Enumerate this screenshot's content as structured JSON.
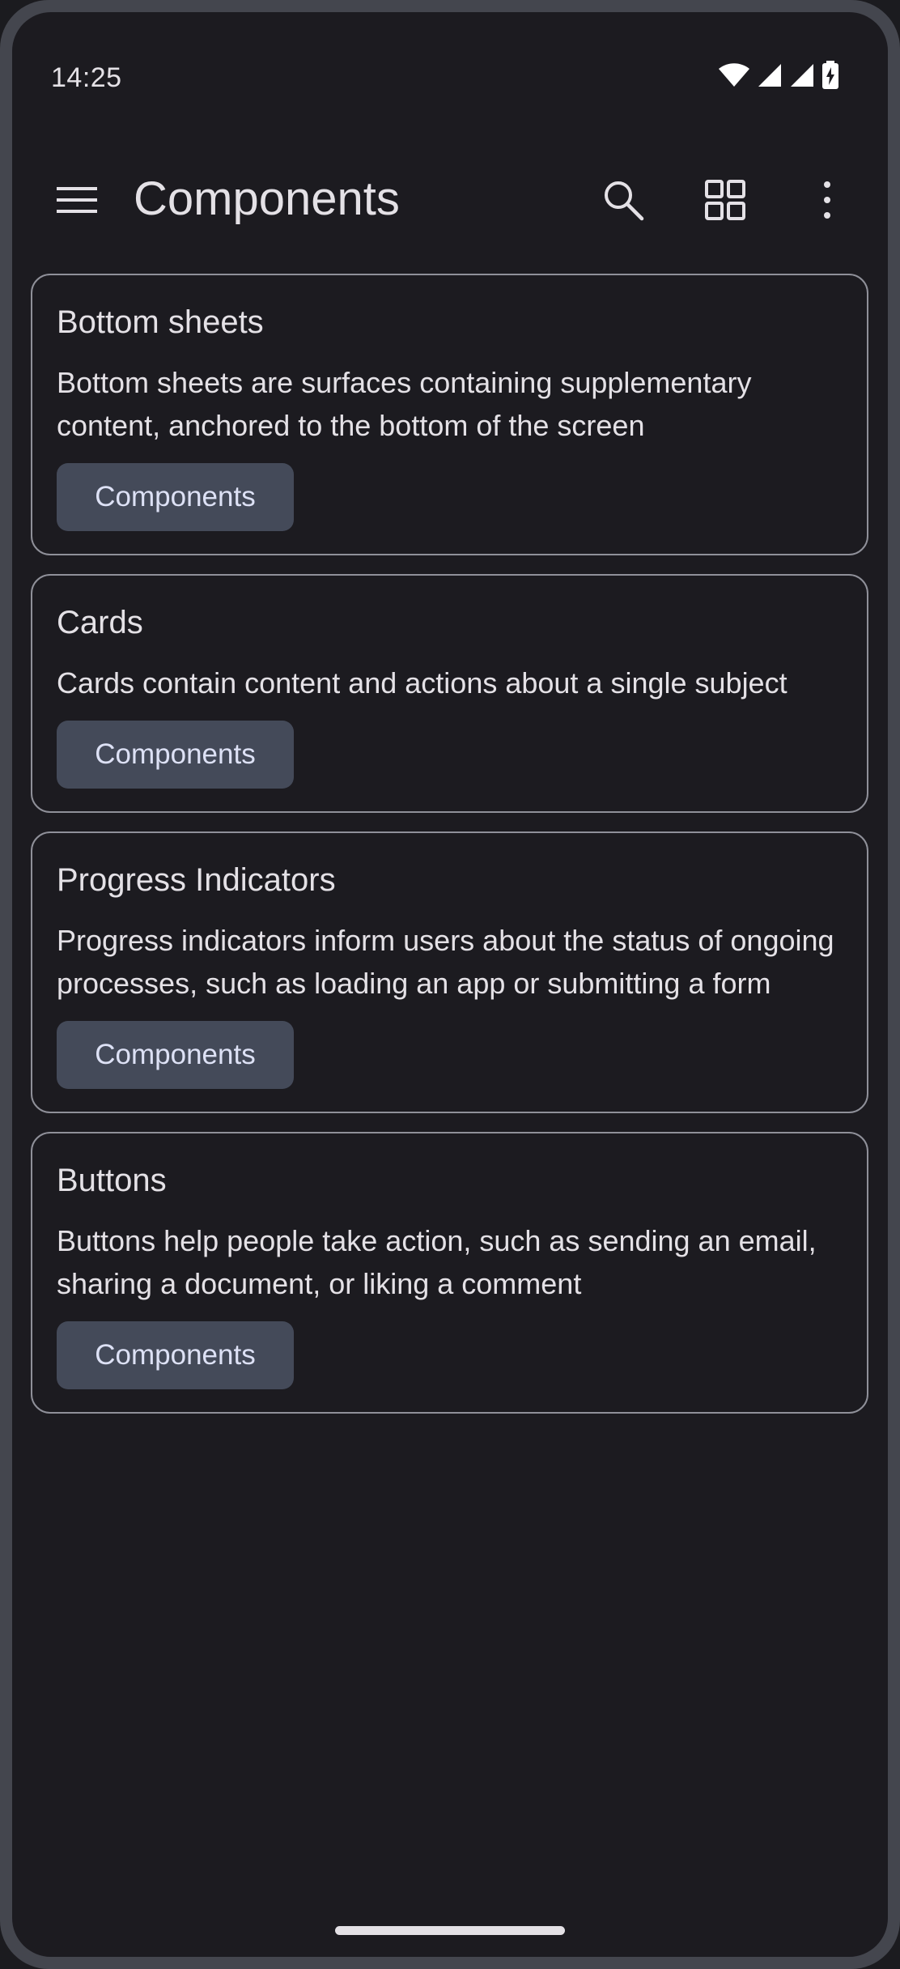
{
  "status_bar": {
    "time": "14:25",
    "icons": [
      "wifi-icon",
      "cell-signal-icon",
      "cell-signal-icon",
      "battery-charging-icon"
    ]
  },
  "app_bar": {
    "title": "Components",
    "nav_icon": "menu-icon",
    "actions": [
      "search-icon",
      "grid-view-icon",
      "more-vert-icon"
    ]
  },
  "cards": [
    {
      "title": "Bottom sheets",
      "description": "Bottom sheets are surfaces containing supplementary content, anchored to the bottom of the screen",
      "button": "Components"
    },
    {
      "title": "Cards",
      "description": "Cards contain content and actions about a single subject",
      "button": "Components"
    },
    {
      "title": "Progress Indicators",
      "description": "Progress indicators inform users about the status of ongoing processes, such as loading an app or submitting a form",
      "button": "Components"
    },
    {
      "title": "Buttons",
      "description": "Buttons help people take action, such as sending an email, sharing a document, or liking a comment",
      "button": "Components"
    }
  ],
  "colors": {
    "background": "#1c1b20",
    "frame": "#44464e",
    "card_border": "#8f9099",
    "button_bg": "#444a59",
    "text": "#e4e1e6"
  }
}
